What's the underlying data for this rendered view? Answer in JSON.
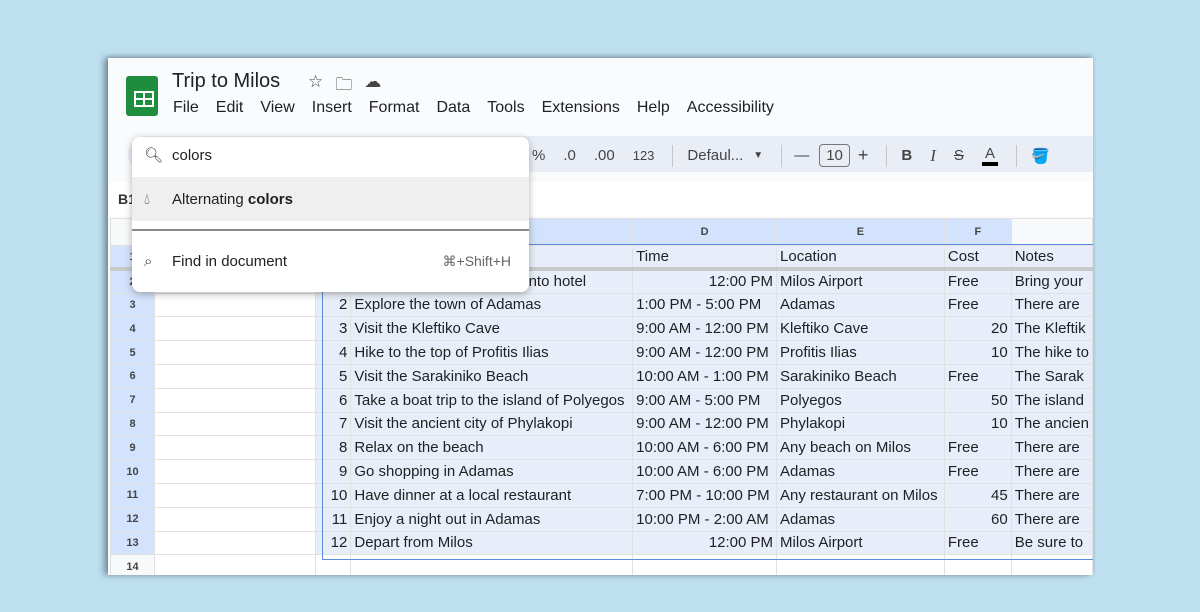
{
  "doc": {
    "title": "Trip to Milos"
  },
  "menu": [
    "File",
    "Edit",
    "View",
    "Insert",
    "Format",
    "Data",
    "Tools",
    "Extensions",
    "Help",
    "Accessibility"
  ],
  "toolbar": {
    "percent": "%",
    "dec_decrease": ".0",
    "dec_increase": ".00",
    "format_123": "123",
    "font": "Defaul...",
    "font_size": "10",
    "bold": "B",
    "italic": "I",
    "strike": "S",
    "text_color": "A"
  },
  "name_box": "B1",
  "search": {
    "query": "colors",
    "result_prefix": "Alternating ",
    "result_match": "colors",
    "find_label": "Find in document",
    "find_shortcut": "⌘+Shift+H"
  },
  "columns": [
    "",
    "",
    "",
    "D",
    "E",
    "F",
    ""
  ],
  "header_row": {
    "b": "",
    "c": "",
    "d": "Time",
    "e": "Location",
    "f": "Cost",
    "g": "Notes"
  },
  "rows": [
    {
      "n": "2",
      "b": "1",
      "c": "Arrive in Milos and check into hotel",
      "d": "12:00 PM",
      "e": "Milos Airport",
      "f": "Free",
      "g": "Bring your"
    },
    {
      "n": "3",
      "b": "2",
      "c": "Explore the town of Adamas",
      "d": "1:00 PM - 5:00 PM",
      "e": "Adamas",
      "f": "Free",
      "g": "There are"
    },
    {
      "n": "4",
      "b": "3",
      "c": "Visit the Kleftiko Cave",
      "d": "9:00 AM - 12:00 PM",
      "e": "Kleftiko Cave",
      "f": "20",
      "g": "The Kleftik"
    },
    {
      "n": "5",
      "b": "4",
      "c": "Hike to the top of Profitis Ilias",
      "d": "9:00 AM - 12:00 PM",
      "e": "Profitis Ilias",
      "f": "10",
      "g": "The hike to"
    },
    {
      "n": "6",
      "b": "5",
      "c": "Visit the Sarakiniko Beach",
      "d": "10:00 AM - 1:00 PM",
      "e": "Sarakiniko Beach",
      "f": "Free",
      "g": "The Sarak"
    },
    {
      "n": "7",
      "b": "6",
      "c": "Take a boat trip to the island of Polyegos",
      "d": "9:00 AM - 5:00 PM",
      "e": "Polyegos",
      "f": "50",
      "g": "The island"
    },
    {
      "n": "8",
      "b": "7",
      "c": "Visit the ancient city of Phylakopi",
      "d": "9:00 AM - 12:00 PM",
      "e": "Phylakopi",
      "f": "10",
      "g": "The ancien"
    },
    {
      "n": "9",
      "b": "8",
      "c": "Relax on the beach",
      "d": "10:00 AM - 6:00 PM",
      "e": "Any beach on Milos",
      "f": "Free",
      "g": "There are"
    },
    {
      "n": "10",
      "b": "9",
      "c": "Go shopping in Adamas",
      "d": "10:00 AM - 6:00 PM",
      "e": "Adamas",
      "f": "Free",
      "g": "There are"
    },
    {
      "n": "11",
      "b": "10",
      "c": "Have dinner at a local restaurant",
      "d": "7:00 PM - 10:00 PM",
      "e": "Any restaurant on Milos",
      "f": "45",
      "g": "There are"
    },
    {
      "n": "12",
      "b": "11",
      "c": "Enjoy a night out in Adamas",
      "d": "10:00 PM - 2:00 AM",
      "e": "Adamas",
      "f": "60",
      "g": "There are"
    },
    {
      "n": "13",
      "b": "12",
      "c": "Depart from Milos",
      "d": "12:00 PM",
      "e": "Milos Airport",
      "f": "Free",
      "g": "Be sure to"
    }
  ],
  "row_numbers": {
    "r1": "1",
    "r14": "14"
  }
}
